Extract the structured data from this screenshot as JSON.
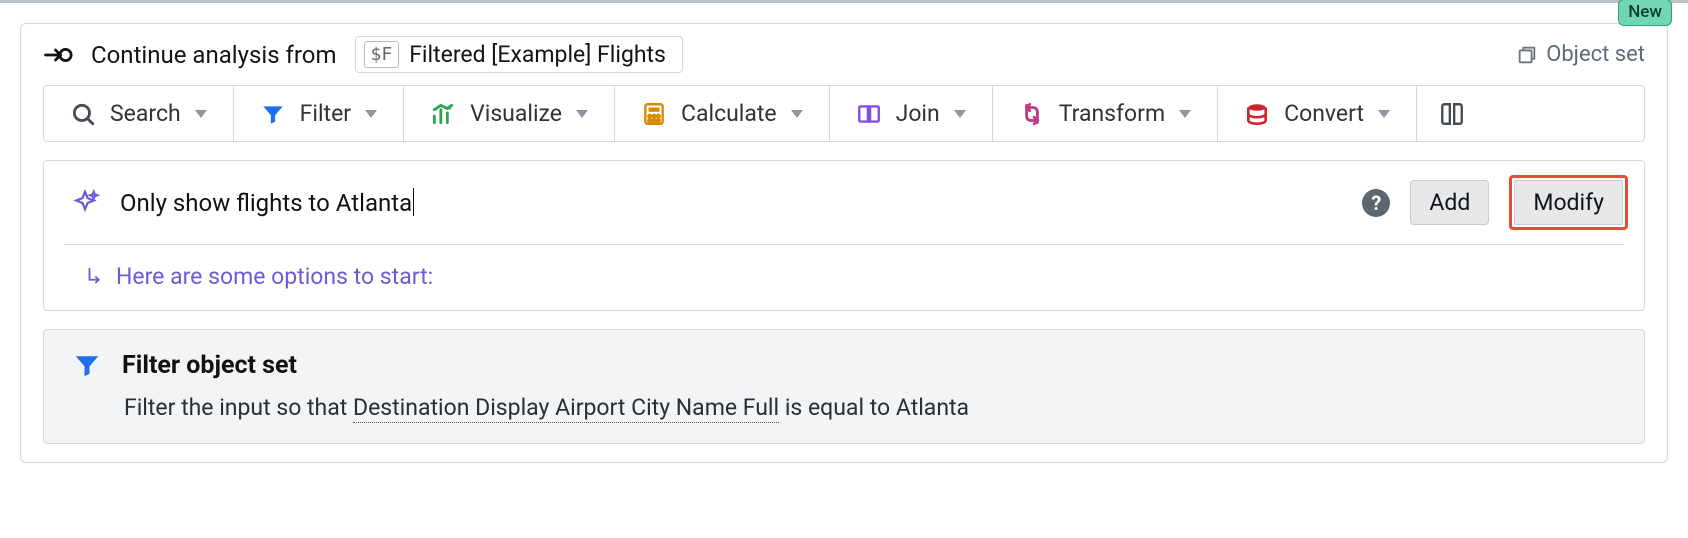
{
  "badge": {
    "label": "New"
  },
  "header": {
    "continue_label": "Continue analysis from",
    "chip_prefix": "$F",
    "chip_label": "Filtered [Example] Flights",
    "object_set_label": "Object set"
  },
  "toolbar": {
    "search": "Search",
    "filter": "Filter",
    "visualize": "Visualize",
    "calculate": "Calculate",
    "join": "Join",
    "transform": "Transform",
    "convert": "Convert"
  },
  "input": {
    "text": "Only show flights to Atlanta",
    "add_label": "Add",
    "modify_label": "Modify",
    "help_glyph": "?"
  },
  "options_hint": "Here are some options to start:",
  "suggestion": {
    "title": "Filter object set",
    "desc_prefix": "Filter the input so that ",
    "desc_field": "Destination Display Airport City Name Full",
    "desc_op": " is equal to ",
    "desc_value": "Atlanta"
  }
}
